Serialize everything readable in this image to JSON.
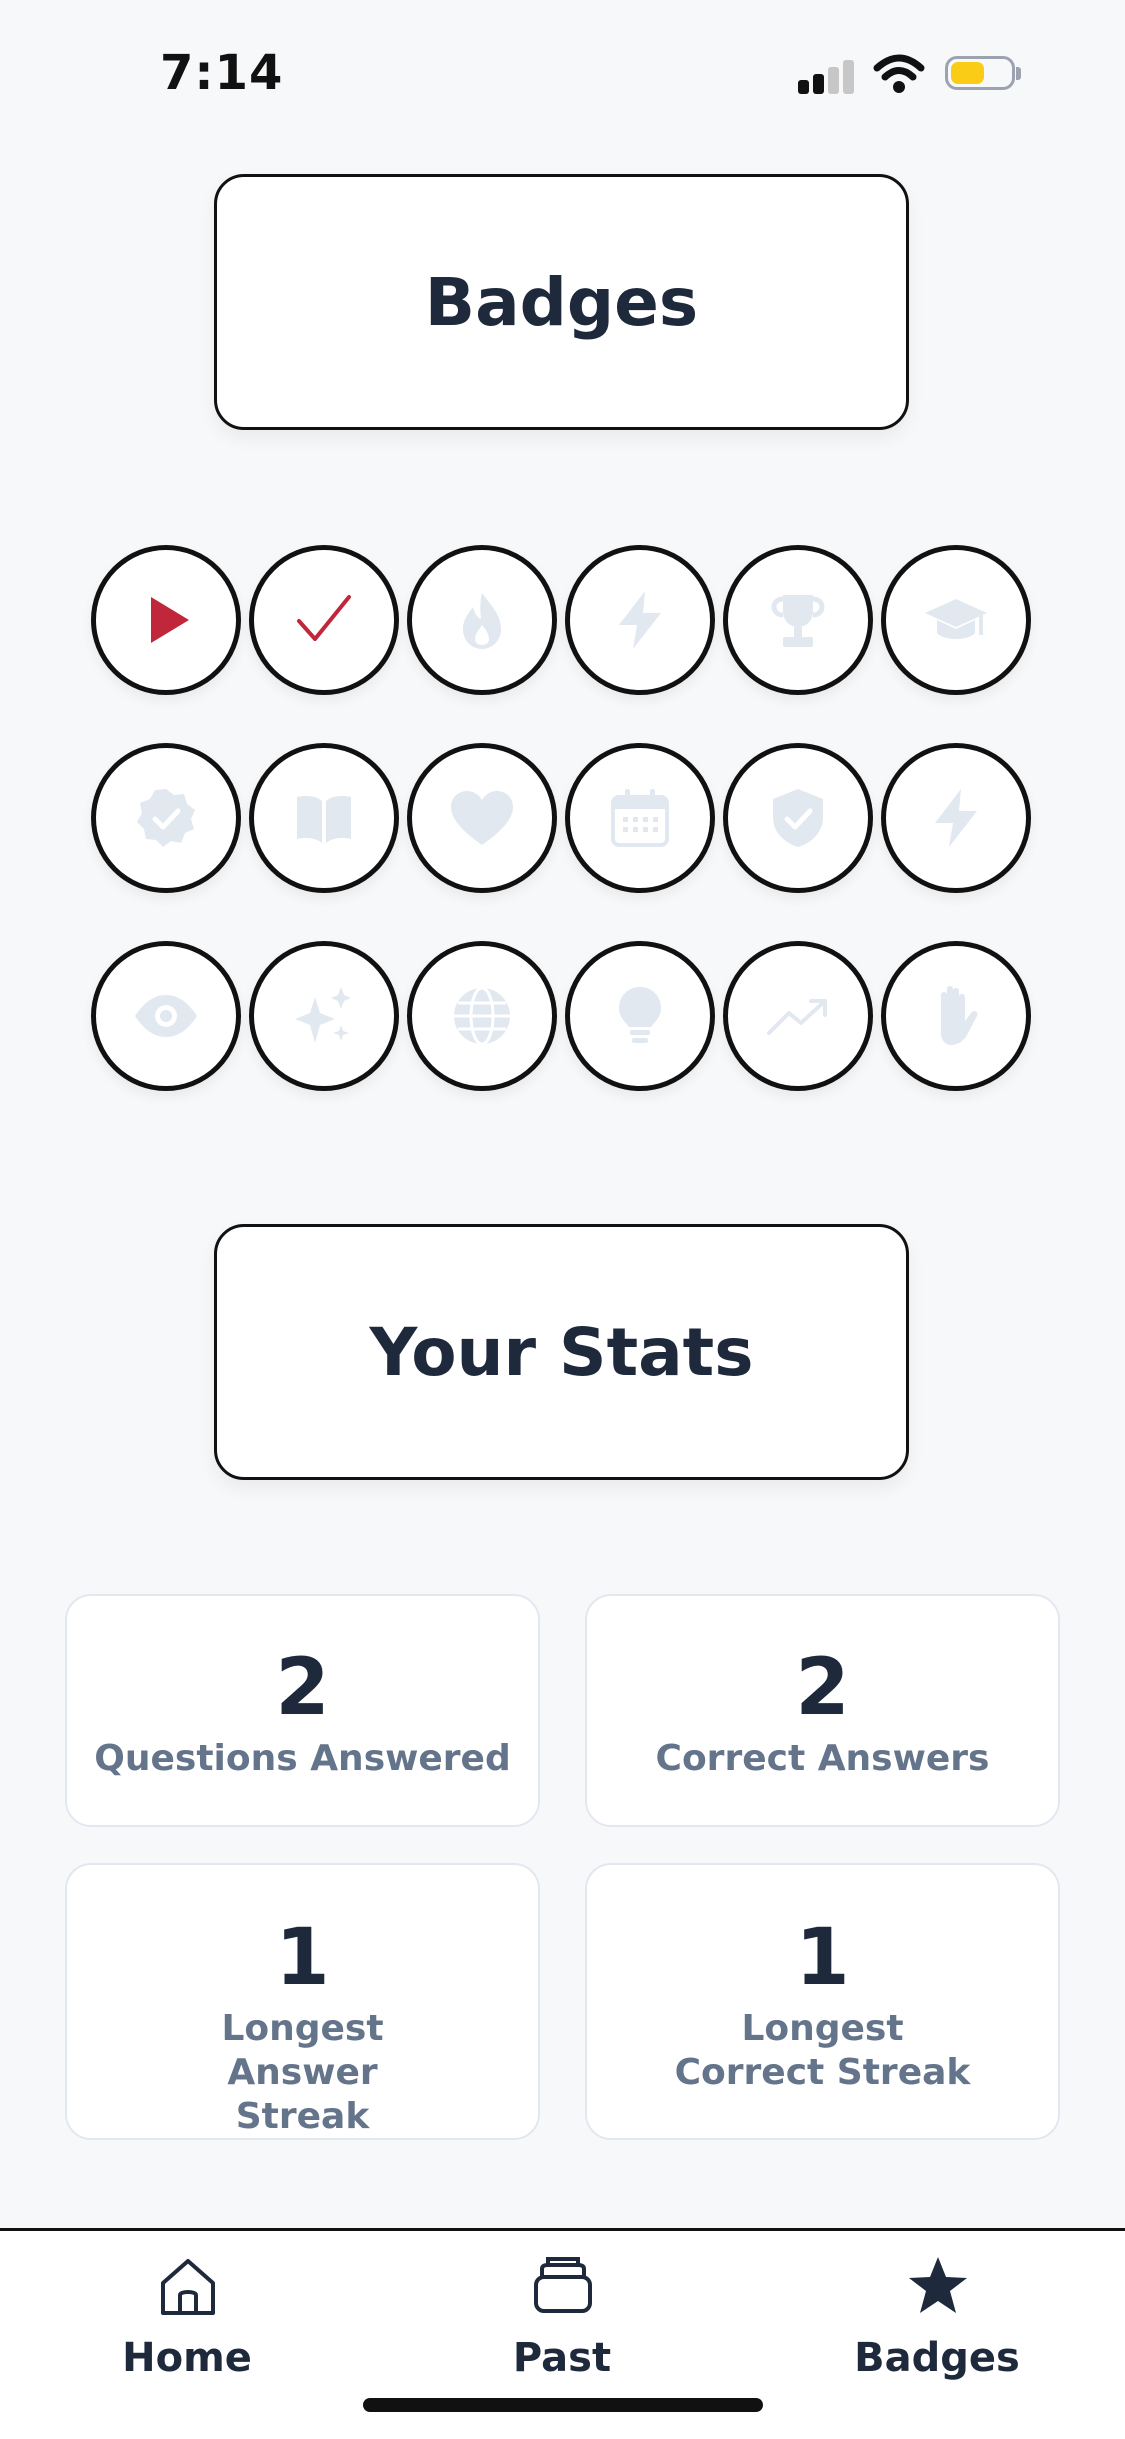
{
  "status_bar": {
    "time": "7:14"
  },
  "badges_heading": "Badges",
  "badges": [
    {
      "icon": "play-icon",
      "earned": true,
      "color": "#c1273a"
    },
    {
      "icon": "checkmark-icon",
      "earned": true,
      "color": "#c1273a"
    },
    {
      "icon": "flame-icon",
      "earned": false
    },
    {
      "icon": "lightning-icon",
      "earned": false
    },
    {
      "icon": "trophy-icon",
      "earned": false
    },
    {
      "icon": "graduation-cap-icon",
      "earned": false
    },
    {
      "icon": "verified-seal-icon",
      "earned": false
    },
    {
      "icon": "open-book-icon",
      "earned": false
    },
    {
      "icon": "heart-icon",
      "earned": false
    },
    {
      "icon": "calendar-icon",
      "earned": false
    },
    {
      "icon": "shield-check-icon",
      "earned": false
    },
    {
      "icon": "lightning-icon",
      "earned": false
    },
    {
      "icon": "eye-icon",
      "earned": false
    },
    {
      "icon": "sparkles-icon",
      "earned": false
    },
    {
      "icon": "globe-icon",
      "earned": false
    },
    {
      "icon": "lightbulb-icon",
      "earned": false
    },
    {
      "icon": "trending-up-icon",
      "earned": false
    },
    {
      "icon": "raised-hand-icon",
      "earned": false
    }
  ],
  "stats_heading": "Your Stats",
  "stats": [
    {
      "value": "2",
      "label": "Questions Answered"
    },
    {
      "value": "2",
      "label": "Correct Answers"
    },
    {
      "value": "1",
      "label": "Longest Answer Streak"
    },
    {
      "value": "1",
      "label": "Longest Correct Streak"
    }
  ],
  "nav": [
    {
      "label": "Home",
      "icon": "home-icon"
    },
    {
      "label": "Past",
      "icon": "stack-icon"
    },
    {
      "label": "Badges",
      "icon": "star-icon"
    }
  ],
  "colors": {
    "earned": "#c1273a",
    "locked": "#e2e8f0",
    "text": "#1e293b",
    "muted": "#64748b"
  }
}
